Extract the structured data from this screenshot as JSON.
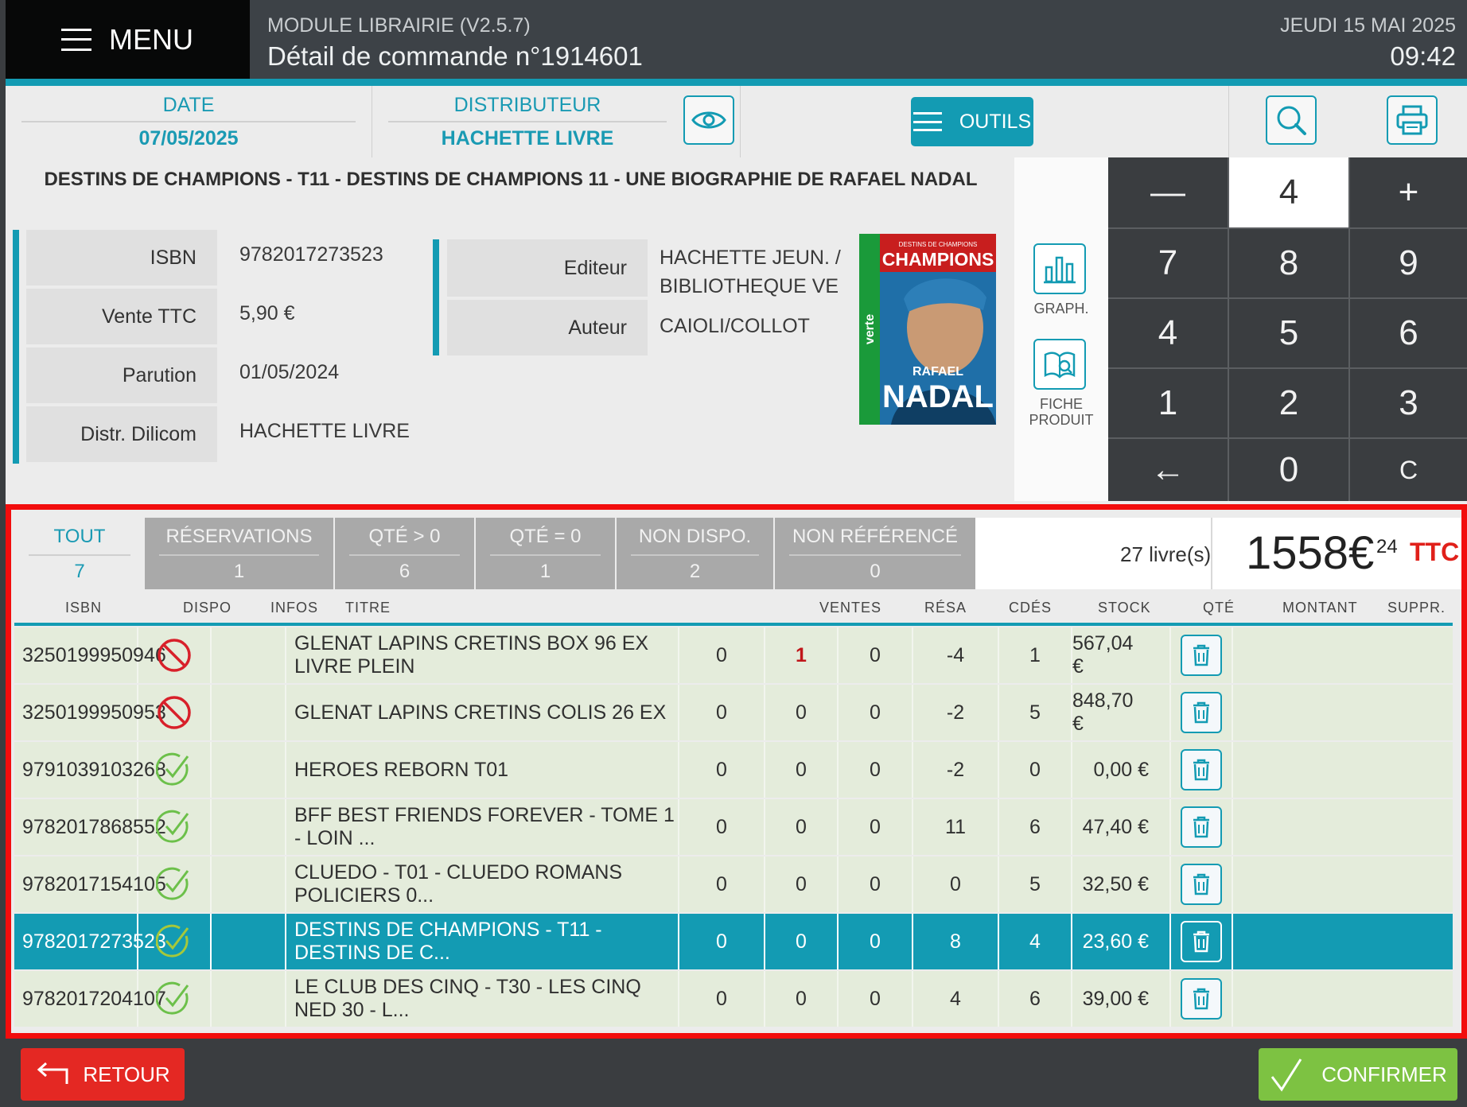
{
  "header": {
    "menu_label": "MENU",
    "module": "MODULE LIBRAIRIE (V2.5.7)",
    "order_title": "Détail de commande n°1914601",
    "date": "JEUDI 15 MAI 2025",
    "time": "09:42"
  },
  "infobar": {
    "date_label": "DATE",
    "date_value": "07/05/2025",
    "distributor_label": "DISTRIBUTEUR",
    "distributor_value": "HACHETTE LIVRE",
    "tools_label": "OUTILS"
  },
  "product": {
    "title": "DESTINS DE CHAMPIONS - T11 - DESTINS DE CHAMPIONS 11 - UNE BIOGRAPHIE DE RAFAEL NADAL",
    "fields_left": [
      {
        "label": "ISBN",
        "value": "9782017273523"
      },
      {
        "label": "Vente TTC",
        "value": "5,90 €"
      },
      {
        "label": "Parution",
        "value": "01/05/2024"
      },
      {
        "label": "Distr. Dilicom",
        "value": "HACHETTE LIVRE"
      }
    ],
    "editeur_label": "Editeur",
    "editeur_line1": "HACHETTE JEUN. /",
    "editeur_line2": "BIBLIOTHEQUE VE",
    "auteur_label": "Auteur",
    "auteur_value": "CAIOLI/COLLOT",
    "cover": {
      "series": "DESTINS DE CHAMPIONS",
      "brand": "CHAMPIONS",
      "side": "verte",
      "subtitle": "RAFAEL",
      "name": "NADAL"
    }
  },
  "tools": {
    "graph_label": "GRAPH.",
    "fiche_label_1": "FICHE",
    "fiche_label_2": "PRODUIT"
  },
  "keypad": {
    "minus": "—",
    "quantity": "4",
    "plus": "+",
    "k7": "7",
    "k8": "8",
    "k9": "9",
    "k4": "4",
    "k5": "5",
    "k6": "6",
    "k1": "1",
    "k2": "2",
    "k3": "3",
    "back": "←",
    "k0": "0",
    "clear": "C"
  },
  "tabs": [
    {
      "label": "TOUT",
      "count": "7"
    },
    {
      "label": "RÉSERVATIONS",
      "count": "1"
    },
    {
      "label": "QTÉ > 0",
      "count": "6"
    },
    {
      "label": "QTÉ = 0",
      "count": "1"
    },
    {
      "label": "NON DISPO.",
      "count": "2"
    },
    {
      "label": "NON RÉFÉRENCÉ",
      "count": "0"
    }
  ],
  "summary": {
    "books": "27 livre(s)",
    "amount": "1558€",
    "cents": "24",
    "ttc": "TTC"
  },
  "columns": {
    "isbn": "ISBN",
    "dispo": "DISPO",
    "infos": "INFOS",
    "titre": "TITRE",
    "ventes": "VENTES",
    "resa": "RÉSA",
    "cdes": "CDÉS",
    "stock": "STOCK",
    "qte": "QTÉ",
    "montant": "MONTANT",
    "suppr": "SUPPR."
  },
  "rows": [
    {
      "isbn": "3250199950946",
      "dispo": "unavailable",
      "titre": "GLENAT LAPINS CRETINS BOX 96 EX LIVRE PLEIN",
      "ventes": "0",
      "resa": "1",
      "cdes": "0",
      "stock": "-4",
      "qte": "1",
      "montant": "567,04 €"
    },
    {
      "isbn": "3250199950953",
      "dispo": "unavailable",
      "titre": "GLENAT LAPINS CRETINS COLIS 26 EX",
      "ventes": "0",
      "resa": "0",
      "cdes": "0",
      "stock": "-2",
      "qte": "5",
      "montant": "848,70 €"
    },
    {
      "isbn": "9791039103268",
      "dispo": "available",
      "titre": "HEROES REBORN T01",
      "ventes": "0",
      "resa": "0",
      "cdes": "0",
      "stock": "-2",
      "qte": "0",
      "montant": "0,00 €"
    },
    {
      "isbn": "9782017868552",
      "dispo": "available",
      "titre": "BFF BEST FRIENDS FOREVER - TOME 1 - LOIN ...",
      "ventes": "0",
      "resa": "0",
      "cdes": "0",
      "stock": "11",
      "qte": "6",
      "montant": "47,40 €"
    },
    {
      "isbn": "9782017154105",
      "dispo": "available",
      "titre": "CLUEDO - T01 - CLUEDO ROMANS POLICIERS 0...",
      "ventes": "0",
      "resa": "0",
      "cdes": "0",
      "stock": "0",
      "qte": "5",
      "montant": "32,50 €"
    },
    {
      "isbn": "9782017273523",
      "dispo": "available",
      "titre": "DESTINS DE CHAMPIONS - T11 - DESTINS DE C...",
      "ventes": "0",
      "resa": "0",
      "cdes": "0",
      "stock": "8",
      "qte": "4",
      "montant": "23,60 €",
      "selected": true
    },
    {
      "isbn": "9782017204107",
      "dispo": "available",
      "titre": "LE CLUB DES CINQ - T30 - LES CINQ NED 30 - L...",
      "ventes": "0",
      "resa": "0",
      "cdes": "0",
      "stock": "4",
      "qte": "6",
      "montant": "39,00 €"
    }
  ],
  "footer": {
    "retour_label": "RETOUR",
    "confirmer_label": "CONFIRMER"
  },
  "colors": {
    "accent": "#139bb3",
    "danger": "#e42823",
    "success": "#7dc242",
    "highlight_border": "#f20d0d"
  }
}
